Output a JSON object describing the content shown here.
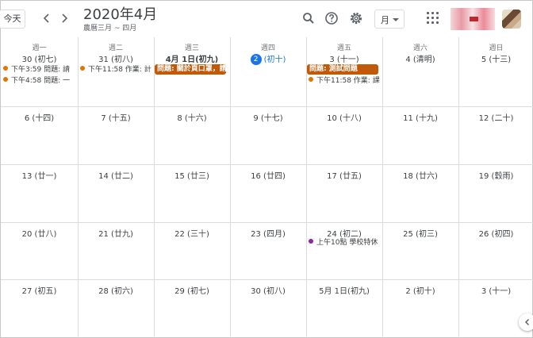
{
  "header": {
    "today_label": "今天",
    "prev_icon": "chevron-left-icon",
    "next_icon": "chevron-right-icon",
    "title": "2020年4月",
    "subtitle": "農曆三月 ~ 四月",
    "search_icon": "search-icon",
    "help_icon": "help-icon",
    "settings_icon": "gear-icon",
    "view_label": "月",
    "apps_icon": "apps-grid-icon",
    "side_toggle_icon": "chevron-left-icon"
  },
  "weekdays": [
    "週一",
    "週二",
    "週三",
    "週四",
    "週五",
    "週六",
    "週日"
  ],
  "weeks": [
    [
      {
        "label": "30 (初七)"
      },
      {
        "label": "31 (初八)"
      },
      {
        "label": "4月 1日(初九)",
        "bold": true
      },
      {
        "num": "2",
        "label": "(初十)",
        "today": true
      },
      {
        "label": "3 (十一)"
      },
      {
        "label": "4 (清明)"
      },
      {
        "label": "5 (十三)"
      }
    ],
    [
      {
        "label": "6 (十四)"
      },
      {
        "label": "7 (十五)"
      },
      {
        "label": "8 (十六)"
      },
      {
        "label": "9 (十七)"
      },
      {
        "label": "10 (十八)"
      },
      {
        "label": "11 (十九)"
      },
      {
        "label": "12 (二十)"
      }
    ],
    [
      {
        "label": "13 (廿一)"
      },
      {
        "label": "14 (廿二)"
      },
      {
        "label": "15 (廿三)"
      },
      {
        "label": "16 (廿四)"
      },
      {
        "label": "17 (廿五)"
      },
      {
        "label": "18 (廿六)"
      },
      {
        "label": "19 (穀雨)"
      }
    ],
    [
      {
        "label": "20 (廿八)"
      },
      {
        "label": "21 (廿九)"
      },
      {
        "label": "22 (三十)"
      },
      {
        "label": "23 (四月)"
      },
      {
        "label": "24 (初二)"
      },
      {
        "label": "25 (初三)"
      },
      {
        "label": "26 (初四)"
      }
    ],
    [
      {
        "label": "27 (初五)"
      },
      {
        "label": "28 (初六)"
      },
      {
        "label": "29 (初七)"
      },
      {
        "label": "30 (初八)"
      },
      {
        "label": "5月 1日(初九)"
      },
      {
        "label": "2 (初十)"
      },
      {
        "label": "3 (十一)"
      }
    ]
  ],
  "events": [
    {
      "week": 0,
      "col": 0,
      "row": 0,
      "text": "下午3:59 問題: 請",
      "color": "#e37400"
    },
    {
      "week": 0,
      "col": 0,
      "row": 1,
      "text": "下午4:58 問題: 一",
      "color": "#e37400"
    },
    {
      "week": 0,
      "col": 1,
      "row": 0,
      "text": "下午11:58 作業: 計",
      "color": "#e37400"
    },
    {
      "week": 0,
      "col": 4,
      "row": 1,
      "text": "下午11:58 作業: 課",
      "color": "#e37400"
    },
    {
      "week": 3,
      "col": 4,
      "row": 0,
      "text": "上午10點 學校特休",
      "color": "#8e24aa"
    }
  ],
  "chips": [
    {
      "week": 0,
      "col": 2,
      "text": "問題: 關於頁口罩，請",
      "color": "#c05a09"
    },
    {
      "week": 0,
      "col": 4,
      "text": "問題: 測試問題",
      "color": "#c05a09"
    }
  ]
}
